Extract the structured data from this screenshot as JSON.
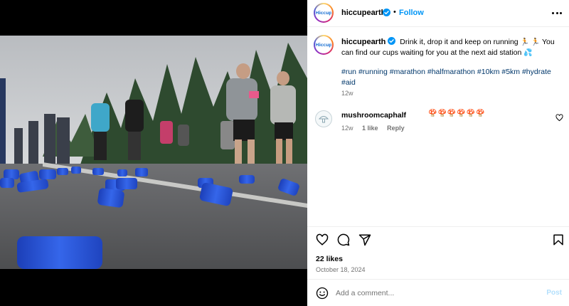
{
  "post": {
    "username": "hiccupearth",
    "avatar_text": "Hiccup",
    "follow_label": "Follow",
    "separator": "•",
    "more_icon": "more-horizontal-icon",
    "verified_color": "#0095f6"
  },
  "caption": {
    "username": "hiccupearth",
    "text": "Drink it, drop it and keep on running",
    "emoji_run": "🏃 🏃",
    "text2": "You can find our cups waiting for you at the next aid station",
    "emoji_drops": "💦",
    "hashtags": [
      "#run",
      "#running",
      "#marathon",
      "#halfmarathon",
      "#10km",
      "#5km",
      "#hydrate",
      "#aid"
    ],
    "timestamp": "12w"
  },
  "comment": {
    "username": "mushroomcaphalf",
    "text": "🍄🍄🍄🍄🍄🍄",
    "timestamp": "12w",
    "likes": "1 like",
    "reply_label": "Reply"
  },
  "actions": {
    "like_icon": "heart-icon",
    "comment_icon": "comment-bubble-icon",
    "share_icon": "send-paper-plane-icon",
    "save_icon": "bookmark-icon"
  },
  "stats": {
    "likes": "22 likes",
    "date": "October 18, 2024"
  },
  "add_comment": {
    "placeholder": "Add a comment...",
    "post_label": "Post",
    "emoji_icon": "smiley-face-icon"
  },
  "colors": {
    "link": "#0095f6",
    "hashtag": "#00376b",
    "muted": "#737373",
    "cup_blue": "#2a55d6"
  }
}
